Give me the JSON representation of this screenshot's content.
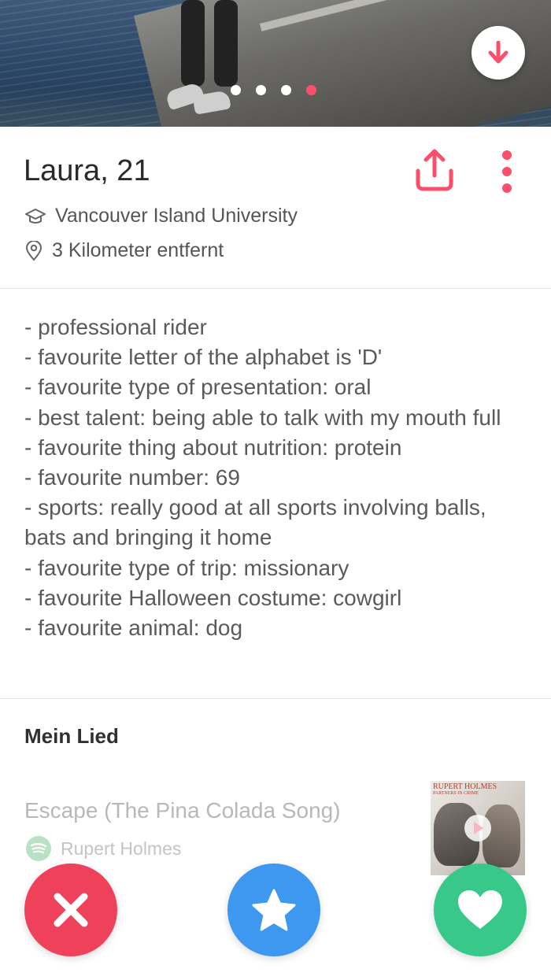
{
  "profile": {
    "name_age": "Laura, 21",
    "school": "Vancouver Island University",
    "distance": "3 Kilometer entfernt",
    "photo_count": 4,
    "active_photo_index": 4
  },
  "bio": "- professional rider\n- favourite letter of the alphabet is 'D'\n- favourite type of presentation: oral\n- best talent: being able to talk with my mouth full\n- favourite thing about nutrition: protein\n- favourite number: 69\n- sports: really good at all sports involving balls, bats and bringing it home\n- favourite type of trip: missionary\n- favourite Halloween costume: cowgirl\n- favourite animal: dog",
  "anthem": {
    "title": "Mein Lied",
    "song": "Escape (The Pina Colada Song)",
    "artist": "Rupert Holmes",
    "album_cover_artist": "RUPERT HOLMES",
    "album_cover_subtitle": "PARTNERS IN CRIME"
  },
  "icons": {
    "photo_down": "arrow-down-icon",
    "share": "share-icon",
    "more": "more-vertical-icon",
    "school": "graduation-cap-icon",
    "distance": "location-pin-icon",
    "spotify": "spotify-icon",
    "play": "play-icon",
    "nope": "x-icon",
    "super_like": "star-icon",
    "like": "heart-icon"
  },
  "colors": {
    "accent": "#fd4f6b",
    "nope": "#f0415a",
    "super_like": "#3e98ef",
    "like": "#38c98a"
  }
}
